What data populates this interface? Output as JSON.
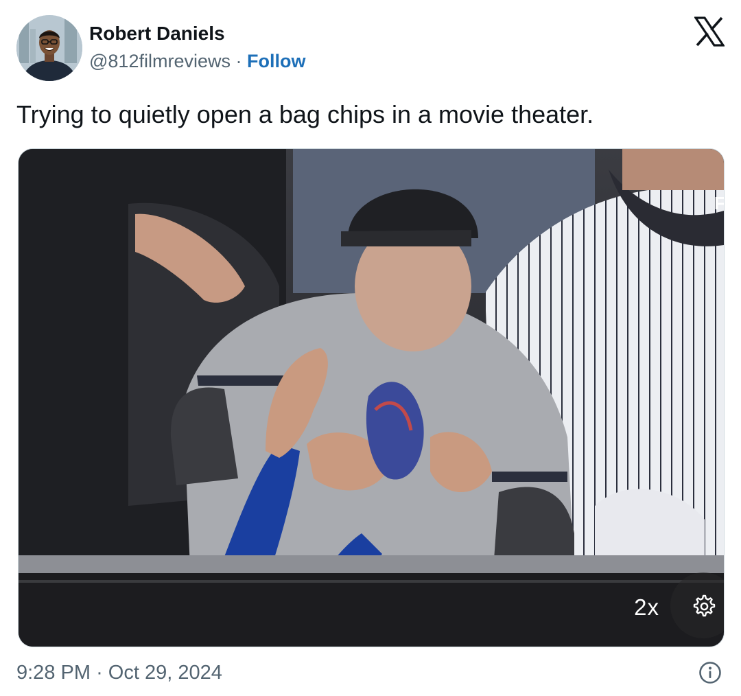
{
  "author": {
    "display_name": "Robert Daniels",
    "handle": "@812filmreviews",
    "separator": "·",
    "follow_label": "Follow",
    "avatar_icon": "profile-photo"
  },
  "brand": {
    "logo_icon": "x-logo",
    "logo_color": "#0f1419"
  },
  "tweet": {
    "text": "Trying to quietly open a bag chips in a movie theater."
  },
  "media": {
    "type": "video",
    "playback_speed": "2x",
    "settings_icon": "gear-icon"
  },
  "footer": {
    "time": "9:28 PM",
    "separator": "·",
    "date": "Oct 29, 2024",
    "info_icon": "info-icon"
  },
  "colors": {
    "link": "#1d6fb8",
    "text": "#0f1419",
    "muted": "#536471"
  }
}
